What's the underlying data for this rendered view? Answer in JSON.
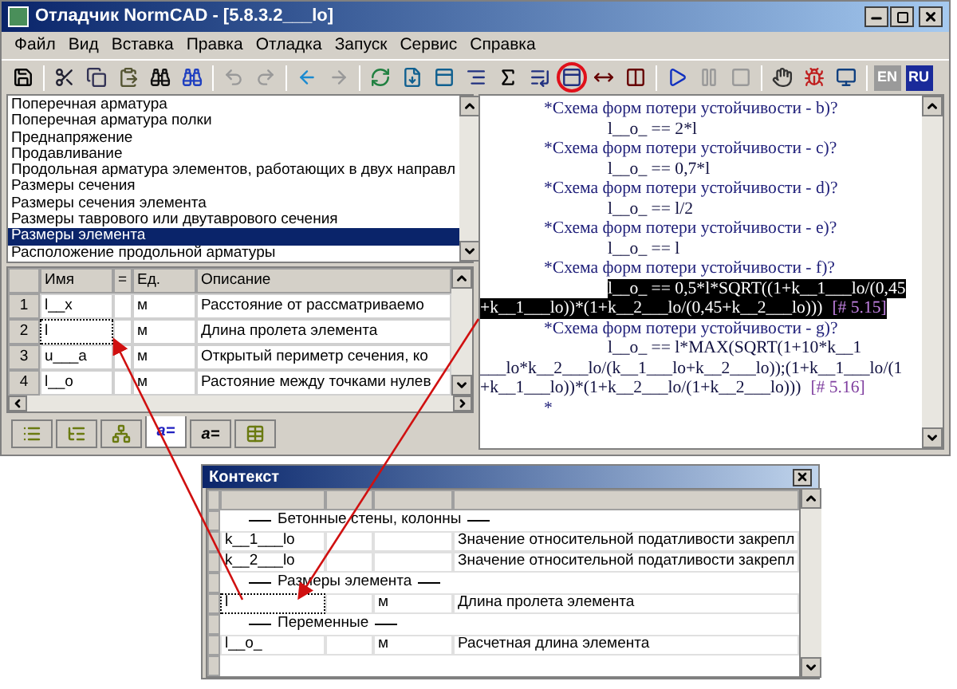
{
  "window": {
    "title": "Отладчик NormCAD - [5.8.3.2___lo]"
  },
  "menu": [
    "Файл",
    "Вид",
    "Вставка",
    "Правка",
    "Отладка",
    "Запуск",
    "Сервис",
    "Справка"
  ],
  "toolbar": {
    "languages": [
      {
        "label": "EN",
        "selected": false
      },
      {
        "label": "RU",
        "selected": true
      }
    ]
  },
  "topics": [
    {
      "label": "Поперечная арматура",
      "selected": false
    },
    {
      "label": "Поперечная арматура полки",
      "selected": false
    },
    {
      "label": "Преднапряжение",
      "selected": false
    },
    {
      "label": "Продавливание",
      "selected": false
    },
    {
      "label": "Продольная арматура элементов, работающих в двух направл",
      "selected": false
    },
    {
      "label": "Размеры сечения",
      "selected": false
    },
    {
      "label": "Размеры сечения элемента",
      "selected": false
    },
    {
      "label": "Размеры таврового или двутаврового сечения",
      "selected": false
    },
    {
      "label": "Размеры элемента",
      "selected": true
    },
    {
      "label": "Расположение продольной арматуры",
      "selected": false
    }
  ],
  "variables": {
    "columns": [
      "Имя",
      "=",
      "Ед.",
      "Описание"
    ],
    "rows": [
      {
        "number": "1",
        "name": "l__x",
        "unit": "м",
        "description": "Расстояние от рассматриваемо",
        "focused": false
      },
      {
        "number": "2",
        "name": "l",
        "unit": "м",
        "description": "Длина пролета элемента",
        "focused": true
      },
      {
        "number": "3",
        "name": "u___a",
        "unit": "м",
        "description": "Открытый периметр сечения, ко",
        "focused": false
      },
      {
        "number": "4",
        "name": "l__o",
        "unit": "м",
        "description": "Растояние между точками нулев",
        "focused": false
      }
    ]
  },
  "bottom_tabs": [
    {
      "kind": "list",
      "selected": false
    },
    {
      "kind": "tree",
      "selected": false
    },
    {
      "kind": "hierarchy",
      "selected": false
    },
    {
      "kind": "text",
      "label": "a=",
      "selected": true
    },
    {
      "kind": "text",
      "label": "a=",
      "selected": false
    },
    {
      "kind": "table",
      "selected": false
    }
  ],
  "editor": {
    "lines": [
      {
        "kind": "heading",
        "text": "*Схема форм потери устойчивости  - b)?",
        "selected": false
      },
      {
        "kind": "formula",
        "text": "l__o_  ==  2*l",
        "selected": false
      },
      {
        "kind": "heading",
        "text": "*Схема форм потери устойчивости  - c)?",
        "selected": false
      },
      {
        "kind": "formula",
        "text": "l__o_  ==  0,7*l",
        "selected": false
      },
      {
        "kind": "heading",
        "text": "*Схема форм потери устойчивости  - d)?",
        "selected": false
      },
      {
        "kind": "formula",
        "text": "l__o_  ==  l/2",
        "selected": false
      },
      {
        "kind": "heading",
        "text": "*Схема форм потери устойчивости  - e)?",
        "selected": false
      },
      {
        "kind": "formula",
        "text": "l__o_  ==  l",
        "selected": false
      },
      {
        "kind": "heading",
        "text": "*Схема форм потери устойчивости  - f)?",
        "selected": false
      },
      {
        "kind": "formula",
        "text": "l__o_  ==  0,5*l*SQRT((1+k__1___lo/(0,45",
        "selected": true
      },
      {
        "kind": "continuation",
        "text": "+k__1___lo))*(1+k__2___lo/(0,45+k__2___lo)))",
        "ref": "[# 5.15]",
        "selected": true
      },
      {
        "kind": "heading",
        "text": "*Схема форм потери устойчивости  - g)?",
        "selected": false
      },
      {
        "kind": "formula",
        "text": "l__o_  ==  l*MAX(SQRT(1+10*k__1",
        "selected": false
      },
      {
        "kind": "continuation",
        "text": "___lo*k__2___lo/(k__1___lo+k__2___lo));(1+k__1___lo/(1",
        "selected": false
      },
      {
        "kind": "continuation",
        "text": "+k__1___lo))*(1+k__2___lo/(1+k__2___lo)))",
        "ref": "[# 5.16]",
        "selected": false
      },
      {
        "kind": "heading",
        "text": "*",
        "selected": false
      }
    ]
  },
  "context": {
    "title": "Контекст",
    "rows": [
      {
        "kind": "group",
        "text": "Бетонные стены, колонны"
      },
      {
        "kind": "item",
        "name": "k__1___lo",
        "description": "Значение относительной податливости закрепл",
        "focused": false
      },
      {
        "kind": "item",
        "name": "k__2___lo",
        "description": "Значение относительной податливости закрепл",
        "focused": false
      },
      {
        "kind": "group",
        "text": "Размеры элемента"
      },
      {
        "kind": "item",
        "name": "l",
        "unit": "м",
        "description": "Длина пролета элемента",
        "focused": true
      },
      {
        "kind": "group",
        "text": "Переменные"
      },
      {
        "kind": "item",
        "name": "l__o_",
        "unit": "м",
        "description": "Расчетная длина элемента",
        "focused": false
      },
      {
        "kind": "empty"
      }
    ]
  }
}
